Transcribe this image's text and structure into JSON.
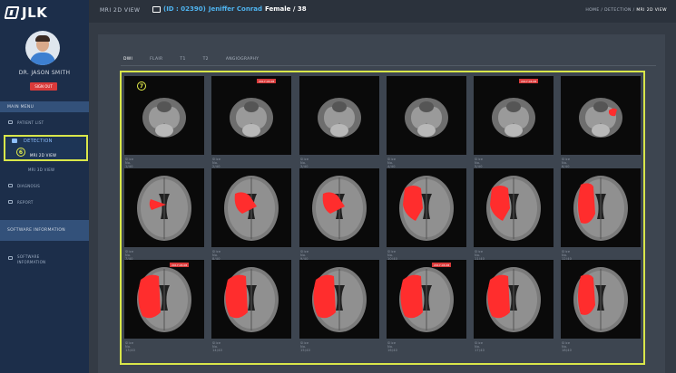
{
  "app": {
    "logo_text": "JLK",
    "view_title": "MRI 2D VIEW",
    "patient": {
      "id": "(ID : 02390)",
      "name": "Jeniffer Conrad",
      "info": "Female / 38"
    },
    "breadcrumb": [
      "HOME",
      "DETECTION",
      "MRI 2D VIEW"
    ]
  },
  "sidebar": {
    "user_name": "DR. JASON SMITH",
    "sign_out": "SIGN OUT",
    "main_menu": "MAIN MENU",
    "items": [
      {
        "label": "PATIENT LIST"
      },
      {
        "label": "DETECTION"
      },
      {
        "label": "MRI 2D VIEW"
      },
      {
        "label": "MRI 3D VIEW"
      },
      {
        "label": "DIAGNOSIS"
      },
      {
        "label": "REPORT"
      }
    ],
    "software_head": "SOFTWARE INFORMATION",
    "software_item": "SOFTWARE INFORMATION",
    "badge_detect": "6",
    "badge_grid": "7"
  },
  "tabs": [
    "DWI",
    "FLAIR",
    "T1",
    "T2",
    "ANGIOGRAPHY"
  ],
  "slices": [
    {
      "label": "Slice No. 1/40",
      "tag": "",
      "lesion": 0
    },
    {
      "label": "Slice No. 2/40",
      "tag": "2017.03.08",
      "lesion": 0
    },
    {
      "label": "Slice No. 3/40",
      "tag": "",
      "lesion": 0
    },
    {
      "label": "Slice No. 4/40",
      "tag": "",
      "lesion": 0
    },
    {
      "label": "Slice No. 5/40",
      "tag": "2017.03.08",
      "lesion": 0
    },
    {
      "label": "Slice No. 6/40",
      "tag": "",
      "lesion": 1
    },
    {
      "label": "Slice No. 7/40",
      "tag": "",
      "lesion": 2
    },
    {
      "label": "Slice No. 8/40",
      "tag": "",
      "lesion": 3
    },
    {
      "label": "Slice No. 9/40",
      "tag": "",
      "lesion": 3
    },
    {
      "label": "Slice No. 10/40",
      "tag": "",
      "lesion": 4
    },
    {
      "label": "Slice No. 11/40",
      "tag": "",
      "lesion": 4
    },
    {
      "label": "Slice No. 12/40",
      "tag": "",
      "lesion": 5
    },
    {
      "label": "Slice No. 13/40",
      "tag": "2017.03.08",
      "lesion": 6
    },
    {
      "label": "Slice No. 14/40",
      "tag": "",
      "lesion": 6
    },
    {
      "label": "Slice No. 15/40",
      "tag": "",
      "lesion": 6
    },
    {
      "label": "Slice No. 16/40",
      "tag": "2017.03.08",
      "lesion": 6
    },
    {
      "label": "Slice No. 17/40",
      "tag": "",
      "lesion": 6
    },
    {
      "label": "Slice No. 18/40",
      "tag": "",
      "lesion": 5
    }
  ],
  "colors": {
    "sidebar": "#1c2e4a",
    "highlight": "#d9e64a",
    "lesion": "#ff2d2d",
    "tag": "#d93a3a",
    "patient_id": "#4fb4f0"
  }
}
